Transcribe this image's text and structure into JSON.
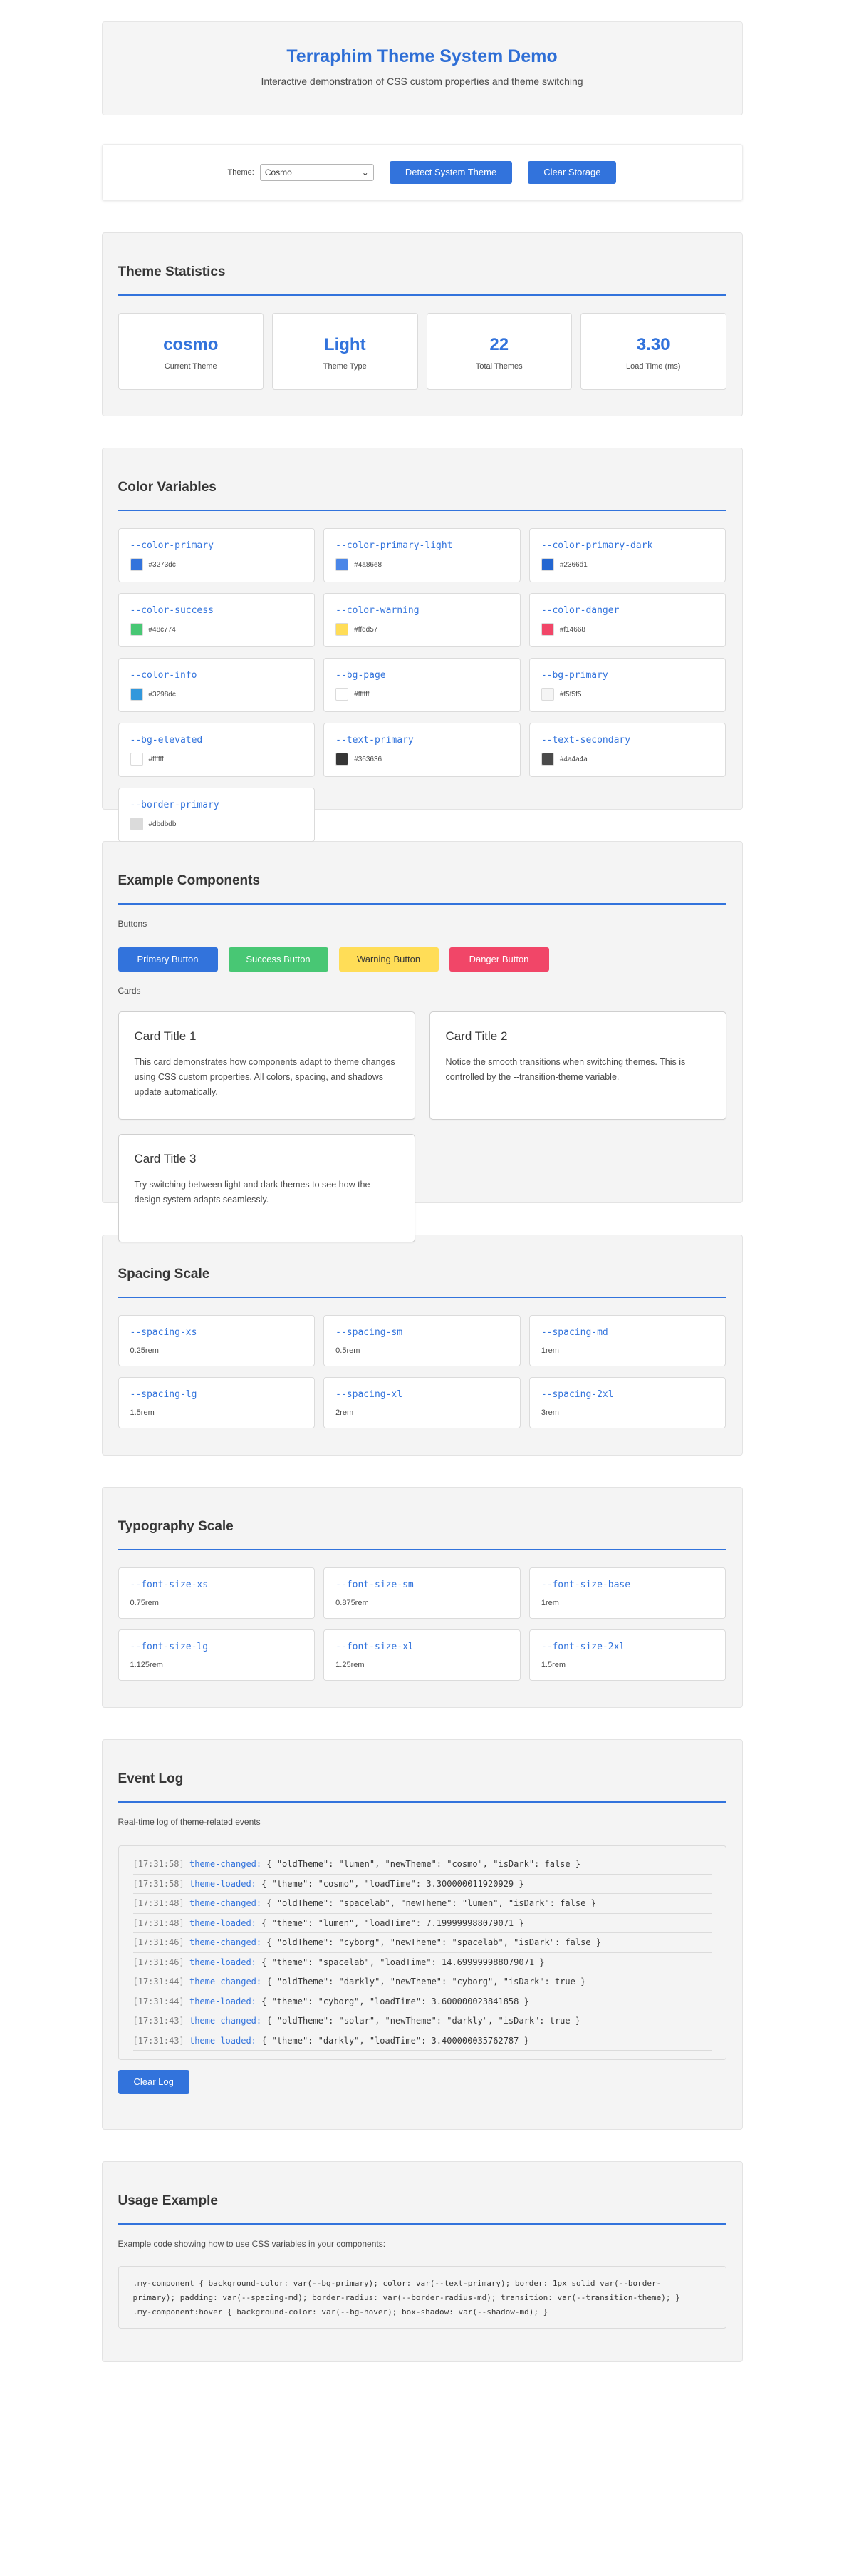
{
  "header": {
    "title": "Terraphim Theme System Demo",
    "subtitle": "Interactive demonstration of CSS custom properties and theme switching"
  },
  "controls": {
    "theme_label": "Theme:",
    "theme_value": "Cosmo",
    "detect_button": "Detect System Theme",
    "clear_storage_button": "Clear Storage"
  },
  "stats": {
    "title": "Theme Statistics",
    "items": [
      {
        "value": "cosmo",
        "label": "Current Theme"
      },
      {
        "value": "Light",
        "label": "Theme Type"
      },
      {
        "value": "22",
        "label": "Total Themes"
      },
      {
        "value": "3.30",
        "label": "Load Time (ms)"
      }
    ]
  },
  "colors": {
    "title": "Color Variables",
    "items": [
      {
        "name": "--color-primary",
        "hex": "#3273dc"
      },
      {
        "name": "--color-primary-light",
        "hex": "#4a86e8"
      },
      {
        "name": "--color-primary-dark",
        "hex": "#2366d1"
      },
      {
        "name": "--color-success",
        "hex": "#48c774"
      },
      {
        "name": "--color-warning",
        "hex": "#ffdd57"
      },
      {
        "name": "--color-danger",
        "hex": "#f14668"
      },
      {
        "name": "--color-info",
        "hex": "#3298dc"
      },
      {
        "name": "--bg-page",
        "hex": "#ffffff"
      },
      {
        "name": "--bg-primary",
        "hex": "#f5f5f5"
      },
      {
        "name": "--bg-elevated",
        "hex": "#ffffff"
      },
      {
        "name": "--text-primary",
        "hex": "#363636"
      },
      {
        "name": "--text-secondary",
        "hex": "#4a4a4a"
      },
      {
        "name": "--border-primary",
        "hex": "#dbdbdb"
      }
    ]
  },
  "components": {
    "title": "Example Components",
    "buttons_label": "Buttons",
    "buttons": [
      {
        "label": "Primary Button",
        "color": "#3273dc"
      },
      {
        "label": "Success Button",
        "color": "#48c774"
      },
      {
        "label": "Warning Button",
        "color": "#ffdd57"
      },
      {
        "label": "Danger Button",
        "color": "#f14668"
      }
    ],
    "cards_label": "Cards",
    "cards": [
      {
        "title": "Card Title 1",
        "body": "This card demonstrates how components adapt to theme changes using CSS custom properties. All colors, spacing, and shadows update automatically."
      },
      {
        "title": "Card Title 2",
        "body": "Notice the smooth transitions when switching themes. This is controlled by the --transition-theme variable."
      },
      {
        "title": "Card Title 3",
        "body": "Try switching between light and dark themes to see how the design system adapts seamlessly."
      }
    ]
  },
  "spacing": {
    "title": "Spacing Scale",
    "items": [
      {
        "name": "--spacing-xs",
        "value": "0.25rem"
      },
      {
        "name": "--spacing-sm",
        "value": "0.5rem"
      },
      {
        "name": "--spacing-md",
        "value": "1rem"
      },
      {
        "name": "--spacing-lg",
        "value": "1.5rem"
      },
      {
        "name": "--spacing-xl",
        "value": "2rem"
      },
      {
        "name": "--spacing-2xl",
        "value": "3rem"
      }
    ]
  },
  "typography": {
    "title": "Typography Scale",
    "items": [
      {
        "name": "--font-size-xs",
        "value": "0.75rem"
      },
      {
        "name": "--font-size-sm",
        "value": "0.875rem"
      },
      {
        "name": "--font-size-base",
        "value": "1rem"
      },
      {
        "name": "--font-size-lg",
        "value": "1.125rem"
      },
      {
        "name": "--font-size-xl",
        "value": "1.25rem"
      },
      {
        "name": "--font-size-2xl",
        "value": "1.5rem"
      }
    ]
  },
  "event_log": {
    "title": "Event Log",
    "description": "Real-time log of theme-related events",
    "entries": [
      {
        "time": "[17:31:58]",
        "event": "theme-changed:",
        "payload": "{ \"oldTheme\": \"lumen\", \"newTheme\": \"cosmo\", \"isDark\": false }"
      },
      {
        "time": "[17:31:58]",
        "event": "theme-loaded:",
        "payload": "{ \"theme\": \"cosmo\", \"loadTime\": 3.300000011920929 }"
      },
      {
        "time": "[17:31:48]",
        "event": "theme-changed:",
        "payload": "{ \"oldTheme\": \"spacelab\", \"newTheme\": \"lumen\", \"isDark\": false }"
      },
      {
        "time": "[17:31:48]",
        "event": "theme-loaded:",
        "payload": "{ \"theme\": \"lumen\", \"loadTime\": 7.199999988079071 }"
      },
      {
        "time": "[17:31:46]",
        "event": "theme-changed:",
        "payload": "{ \"oldTheme\": \"cyborg\", \"newTheme\": \"spacelab\", \"isDark\": false }"
      },
      {
        "time": "[17:31:46]",
        "event": "theme-loaded:",
        "payload": "{ \"theme\": \"spacelab\", \"loadTime\": 14.699999988079071 }"
      },
      {
        "time": "[17:31:44]",
        "event": "theme-changed:",
        "payload": "{ \"oldTheme\": \"darkly\", \"newTheme\": \"cyborg\", \"isDark\": true }"
      },
      {
        "time": "[17:31:44]",
        "event": "theme-loaded:",
        "payload": "{ \"theme\": \"cyborg\", \"loadTime\": 3.600000023841858 }"
      },
      {
        "time": "[17:31:43]",
        "event": "theme-changed:",
        "payload": "{ \"oldTheme\": \"solar\", \"newTheme\": \"darkly\", \"isDark\": true }"
      },
      {
        "time": "[17:31:43]",
        "event": "theme-loaded:",
        "payload": "{ \"theme\": \"darkly\", \"loadTime\": 3.400000035762787 }"
      }
    ],
    "clear_button": "Clear Log"
  },
  "usage": {
    "title": "Usage Example",
    "description": "Example code showing how to use CSS variables in your components:",
    "code_lines": [
      ".my-component { background-color: var(--bg-primary); color: var(--text-primary); border: 1px solid var(--border-",
      "primary); padding: var(--spacing-md); border-radius: var(--border-radius-md); transition: var(--transition-theme); }",
      ".my-component:hover { background-color: var(--bg-hover); box-shadow: var(--shadow-md); }"
    ]
  }
}
